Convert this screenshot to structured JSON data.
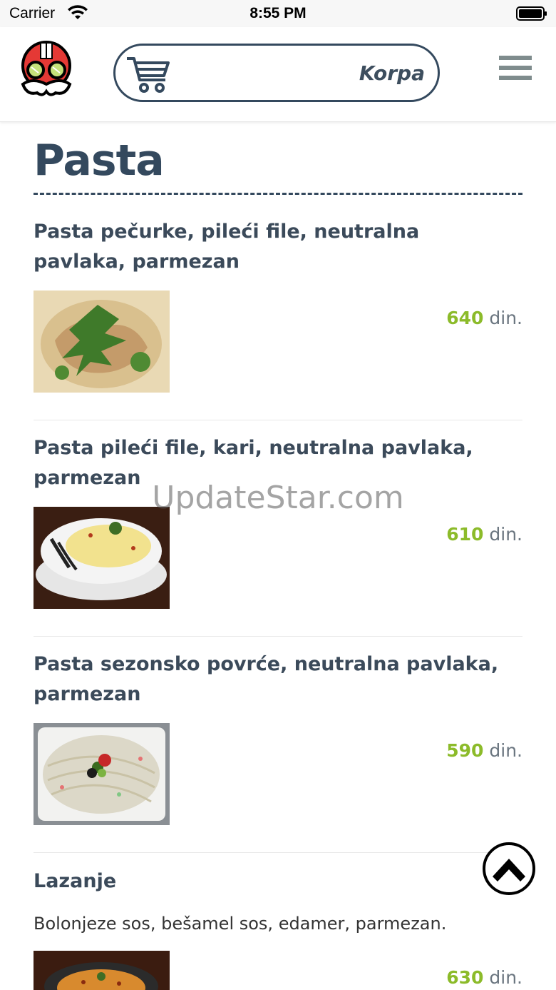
{
  "status_bar": {
    "carrier": "Carrier",
    "time": "8:55 PM"
  },
  "header": {
    "cart_label": "Korpa"
  },
  "page": {
    "title": "Pasta"
  },
  "items": [
    {
      "name": "Pasta pečurke, pileći file, neutralna pavlaka, parmezan",
      "description": "",
      "price_amount": "640",
      "price_currency": " din."
    },
    {
      "name": "Pasta pileći file, kari, neutralna pavlaka, parmezan",
      "description": "",
      "price_amount": "610",
      "price_currency": " din."
    },
    {
      "name": "Pasta sezonsko povrće, neutralna pavlaka, parmezan",
      "description": "",
      "price_amount": "590",
      "price_currency": " din."
    },
    {
      "name": "Lazanje",
      "description": "Bolonjeze sos, bešamel sos, edamer, parmezan.",
      "price_amount": "630",
      "price_currency": " din."
    }
  ],
  "watermark": "UpdateStar.com",
  "colors": {
    "primary_text": "#34495e",
    "price_accent": "#8cbb2a",
    "menu_icon": "#7f8c8d"
  },
  "icons": {
    "logo": "chef-mascot-logo",
    "cart": "shopping-cart-icon",
    "menu": "hamburger-menu-icon",
    "scroll_top": "chevron-up-icon"
  }
}
